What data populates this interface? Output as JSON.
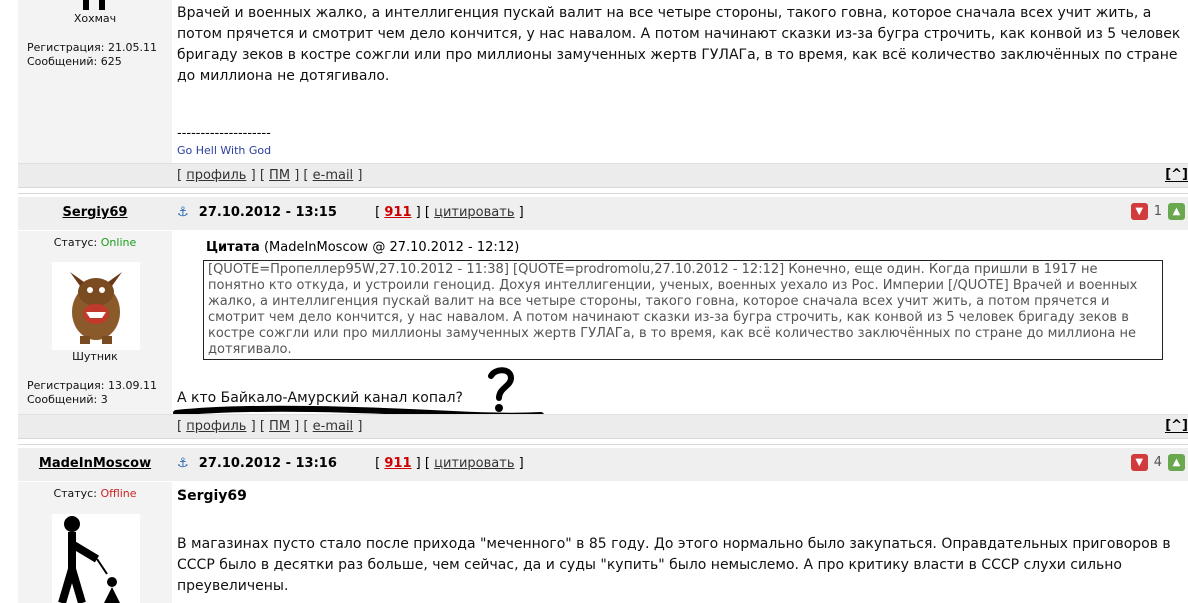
{
  "post0": {
    "author": "Хохмач",
    "registration": "Регистрация: 21.05.11",
    "messages": "Сообщений: 625",
    "text": "Врачей и военных жалко, а интеллигенция пускай валит на все четыре стороны, такого говна, которое сначала всех учит жить, а потом прячется и смотрит чем дело кончится, у нас навалом. А потом начинают сказки из-за бугра строчить, как конвой из 5 человек бригаду зеков в костре сожгли или про миллионы замученных жертв ГУЛАГа, в то время, как всё количество заключённых по стране до миллиона не дотягивало.",
    "sig_line": "--------------------",
    "sig": "Go Hell With God"
  },
  "links": {
    "lb": "[",
    "rb": "]",
    "profile": "профиль",
    "pm": "ПМ",
    "email": "e-mail",
    "top": "[^]"
  },
  "post1": {
    "author": "Sergiy69",
    "anchor": "⚓",
    "date": "27.10.2012 - 13:15",
    "num": "911",
    "quote_btn": "цитировать",
    "votes": "1",
    "status_label": "Статус:",
    "status": "Online",
    "rank": "Шутник",
    "registration": "Регистрация: 13.09.11",
    "messages": "Сообщений: 3",
    "quote_title": "Цитата",
    "quote_meta": "(MadeInMoscow @ 27.10.2012 - 12:12)",
    "quote_text": "[QUOTE=Пропеллер95W,27.10.2012 - 11:38] [QUOTE=prodromolu,27.10.2012 - 12:12] Конечно, еще один. Когда пришли в 1917 не понятно кто откуда, и устроили геноцид. Дохуя интеллигенции, ученых, военных уехало из Рос. Империи [/QUOTE] Врачей и военных жалко, а интеллигенция пускай валит на все четыре стороны, такого говна, которое сначала всех учит жить, а потом прячется и смотрит чем дело кончится, у нас навалом. А потом начинают сказки из-за бугра строчить, как конвой из 5 человек бригаду зеков в костре сожгли или про миллионы замученных жертв ГУЛАГа, в то время, как всё количество заключённых по стране до миллиона не дотягивало.",
    "text": "А кто Байкало-Амурский канал копал?"
  },
  "post2": {
    "author": "MadeInMoscow",
    "anchor": "⚓",
    "date": "27.10.2012 - 13:16",
    "num": "911",
    "quote_btn": "цитировать",
    "votes": "4",
    "status_label": "Статус:",
    "status": "Offline",
    "addressee": "Sergiy69",
    "text": "В магазинах пусто стало после прихода \"меченного\" в 85 году. До этого нормально было закупаться. Оправдательных приговоров в СССР было в десятки раз больше, чем сейчас, да и суды \"купить\" было немыслемо. А про критику власти в СССР слухи сильно преувеличены."
  },
  "icons": {
    "vote_down": "thumb-down-icon",
    "vote_up": "thumb-up-icon",
    "anchor": "anchor-icon"
  },
  "colors": {
    "online": "#1a9c1a",
    "offline": "#cc2222",
    "post_number": "#cc0000",
    "signature": "#2a3fa0"
  }
}
